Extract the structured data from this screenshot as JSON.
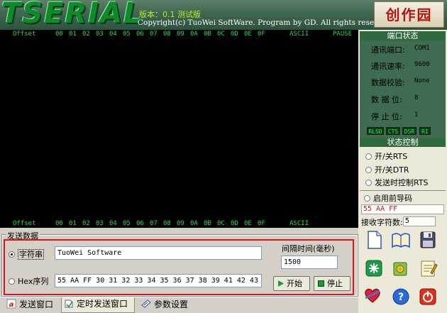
{
  "header": {
    "logo": "TSERIAL",
    "version": "版本：0.1 测试版",
    "copyright": "Copyright(c) TuoWei SoftWare. Program by GD. All rights reserved.",
    "brand": "创作园"
  },
  "display": {
    "offset_label": "Offset",
    "hex_columns": [
      "00",
      "01",
      "02",
      "03",
      "04",
      "05",
      "06",
      "07",
      "08",
      "09",
      "0A",
      "0B",
      "0C",
      "0D",
      "0E",
      "0F"
    ],
    "ascii_label": "ASCII",
    "pause_label": "PAUSE"
  },
  "port_status": {
    "title": "端口状态",
    "rows": [
      {
        "label": "通讯端口:",
        "value": "COM1"
      },
      {
        "label": "通讯速率:",
        "value": "9600"
      },
      {
        "label": "数据校验:",
        "value": "None"
      },
      {
        "label": "数 据 位:",
        "value": "8"
      },
      {
        "label": "停 止 位:",
        "value": "1"
      }
    ],
    "leds": [
      "RLSD",
      "CTS",
      "DSR",
      "RI"
    ]
  },
  "status_control": {
    "title": "状态控制",
    "options": [
      "开/关RTS",
      "开/关DTR",
      "发送时控制RTS",
      "启用前导码"
    ],
    "pre_code_value": "55 AA FF",
    "recv_count_label": "接收字符数:",
    "recv_count_value": "5"
  },
  "send": {
    "group_label": "发送数据",
    "string_label": "字符串",
    "string_value": "TuoWei Software",
    "hex_label": "Hex序列",
    "hex_value": "55 AA FF 30 31 32 33 34 35 36 37 38 39 41 42 43",
    "interval_label": "间隔时间(毫秒)",
    "interval_value": "1500",
    "start_label": "开始",
    "stop_label": "停止"
  },
  "tabs": [
    {
      "label": "发送窗口"
    },
    {
      "label": "定时发送窗口"
    },
    {
      "label": "参数设置"
    }
  ],
  "colors": {
    "accent_green": "#2f6a3f",
    "display_text": "#24d84a",
    "highlight_red": "#e0141c"
  }
}
